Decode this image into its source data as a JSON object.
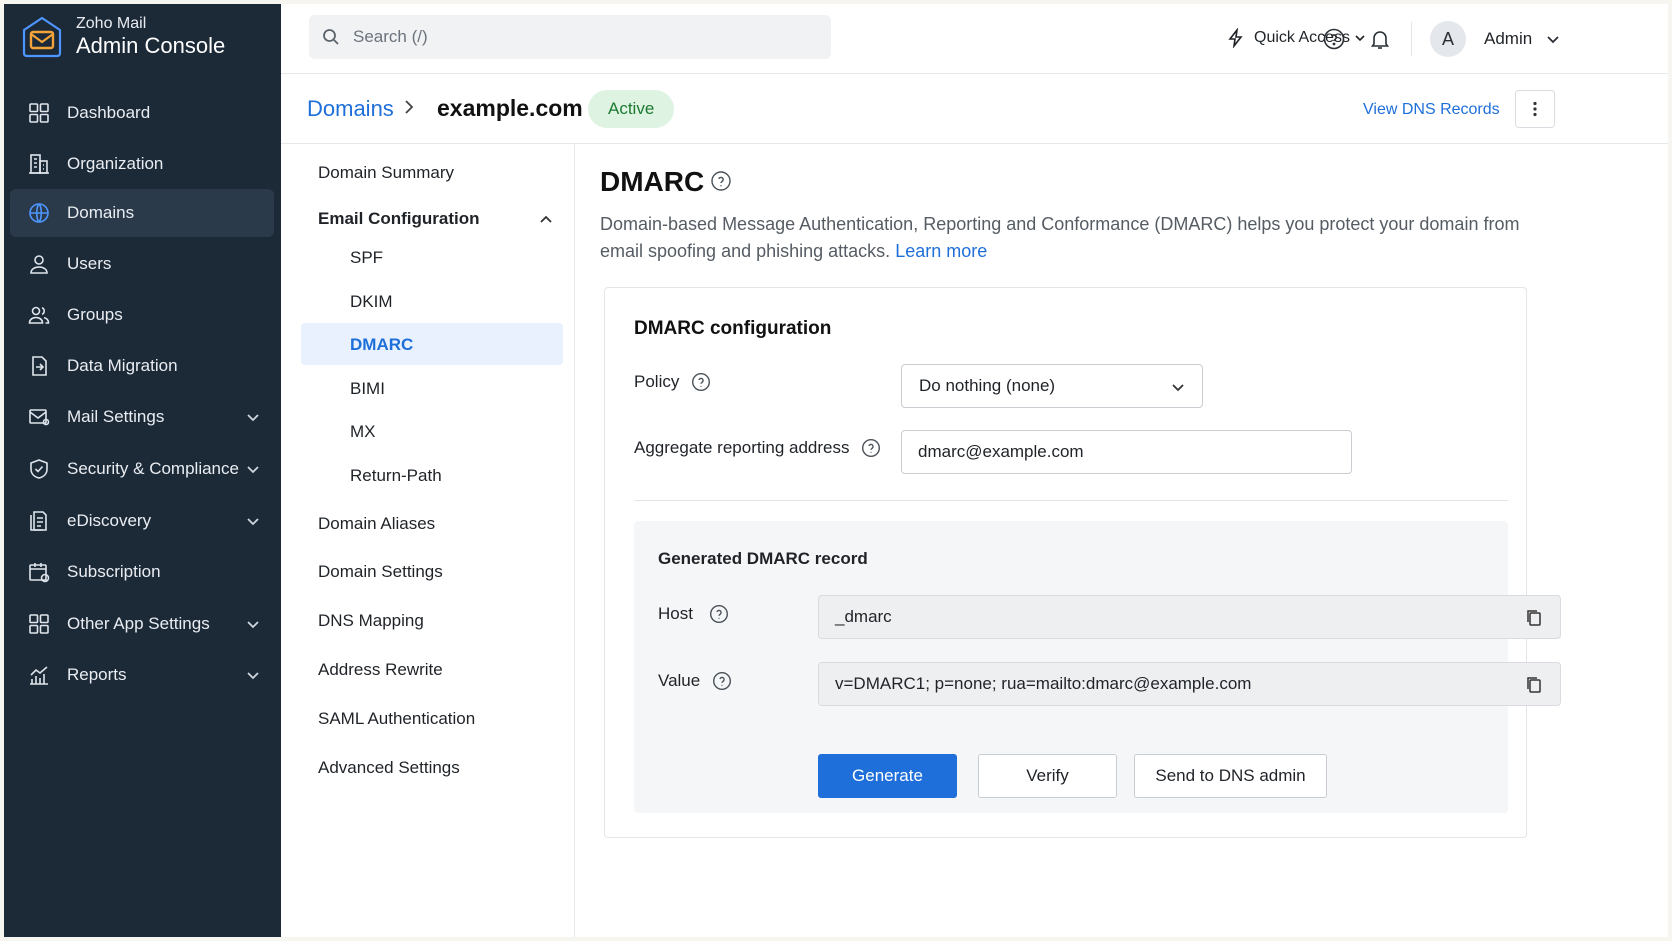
{
  "brand": {
    "line1": "Zoho Mail",
    "line2": "Admin Console"
  },
  "sidebar": {
    "items": [
      {
        "label": "Dashboard",
        "icon": "dashboard-grid-icon"
      },
      {
        "label": "Organization",
        "icon": "building-icon"
      },
      {
        "label": "Domains",
        "icon": "globe-icon",
        "active": true
      },
      {
        "label": "Users",
        "icon": "user-icon"
      },
      {
        "label": "Groups",
        "icon": "users-icon"
      },
      {
        "label": "Data Migration",
        "icon": "migration-icon"
      },
      {
        "label": "Mail Settings",
        "icon": "mail-gear-icon",
        "expandable": true
      },
      {
        "label": "Security & Compliance",
        "icon": "shield-icon",
        "expandable": true
      },
      {
        "label": "eDiscovery",
        "icon": "document-search-icon",
        "expandable": true
      },
      {
        "label": "Subscription",
        "icon": "calendar-icon"
      },
      {
        "label": "Other App Settings",
        "icon": "grid-icon",
        "expandable": true
      },
      {
        "label": "Reports",
        "icon": "chart-icon",
        "expandable": true
      }
    ]
  },
  "topbar": {
    "search_placeholder": "Search (/)",
    "quick_access": "Quick Access",
    "avatar_initial": "A",
    "user_name": "Admin"
  },
  "header": {
    "breadcrumb_parent": "Domains",
    "breadcrumb_current": "example.com",
    "status": "Active",
    "view_dns": "View DNS Records"
  },
  "subnav": {
    "domain_summary": "Domain Summary",
    "email_configuration": "Email Configuration",
    "email_children": [
      "SPF",
      "DKIM",
      "DMARC",
      "BIMI",
      "MX",
      "Return-Path"
    ],
    "domain_aliases": "Domain Aliases",
    "domain_settings": "Domain Settings",
    "dns_mapping": "DNS Mapping",
    "address_rewrite": "Address Rewrite",
    "saml": "SAML Authentication",
    "advanced": "Advanced Settings"
  },
  "content": {
    "title": "DMARC",
    "description": "Domain-based Message Authentication, Reporting and Conformance (DMARC) helps you protect your domain from email spoofing and phishing attacks.",
    "learn_more": "Learn more",
    "card_title": "DMARC configuration",
    "policy_label": "Policy",
    "policy_value": "Do nothing (none)",
    "aggregate_label": "Aggregate reporting address",
    "aggregate_value": "dmarc@example.com",
    "generated_title": "Generated DMARC record",
    "host_label": "Host",
    "host_value": "_dmarc",
    "value_label": "Value",
    "value_value": "v=DMARC1; p=none; rua=mailto:dmarc@example.com",
    "generate_btn": "Generate",
    "verify_btn": "Verify",
    "send_btn": "Send to DNS admin"
  },
  "colors": {
    "accent": "#1e6fd9",
    "sidebar_bg": "#1c2937",
    "active_badge_bg": "#def3e1",
    "active_badge_text": "#1d7a33"
  }
}
